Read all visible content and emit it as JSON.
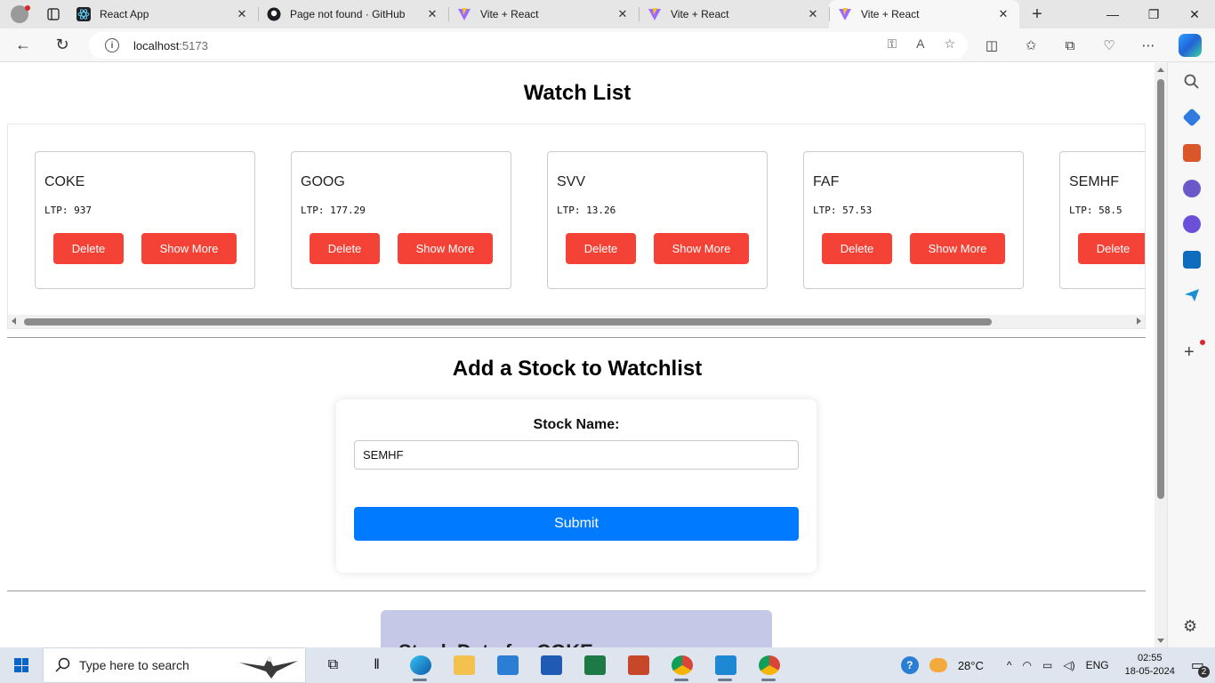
{
  "browser": {
    "tabs": [
      {
        "label": "React App",
        "icon": "react-icon",
        "active": false
      },
      {
        "label": "Page not found · GitHub",
        "icon": "github-icon",
        "active": false
      },
      {
        "label": "Vite + React",
        "icon": "vite-icon",
        "active": false
      },
      {
        "label": "Vite + React",
        "icon": "vite-icon",
        "active": false
      },
      {
        "label": "Vite + React",
        "icon": "vite-icon",
        "active": true
      }
    ],
    "url_host": "localhost",
    "url_port": ":5173"
  },
  "page": {
    "watchlist_title": "Watch List",
    "stocks": [
      {
        "name": "COKE",
        "ltp": "LTP: 937"
      },
      {
        "name": "GOOG",
        "ltp": "LTP: 177.29"
      },
      {
        "name": "SVV",
        "ltp": "LTP: 13.26"
      },
      {
        "name": "FAF",
        "ltp": "LTP: 57.53"
      },
      {
        "name": "SEMHF",
        "ltp": "LTP: 58.5"
      }
    ],
    "delete_label": "Delete",
    "show_more_label": "Show More",
    "add_title": "Add a Stock to Watchlist",
    "form": {
      "label": "Stock Name:",
      "value": "SEMHF",
      "submit_label": "Submit"
    },
    "details_title": "Stock Data for COKE"
  },
  "taskbar": {
    "search_placeholder": "Type here to search",
    "weather": "28°C",
    "language": "ENG",
    "time": "02:55",
    "date": "18-05-2024",
    "notifications": "2"
  },
  "colors": {
    "danger": "#f44336",
    "primary": "#007bff",
    "details_bg": "#c5c8e6"
  }
}
